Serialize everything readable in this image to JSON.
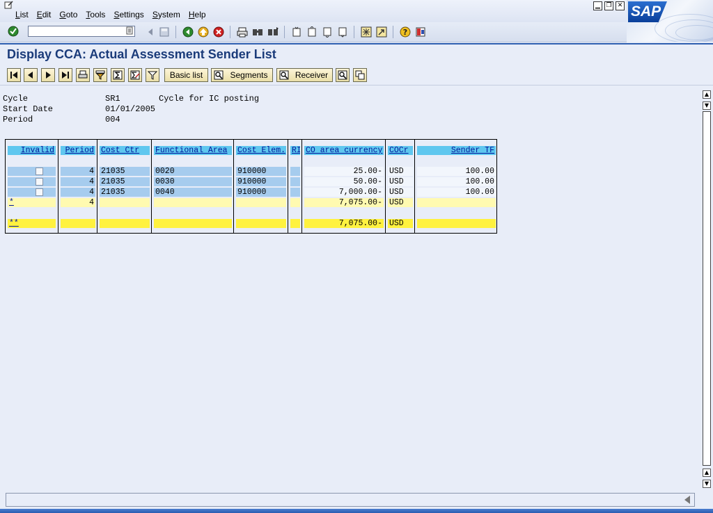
{
  "menu": {
    "items": [
      "List",
      "Edit",
      "Goto",
      "Tools",
      "Settings",
      "System",
      "Help"
    ]
  },
  "logo_text": "SAP",
  "window_controls": [
    "minimize-icon",
    "restore-icon",
    "close-icon"
  ],
  "command_field": {
    "value": ""
  },
  "page_title": "Display CCA: Actual Assessment Sender List",
  "app_toolbar": {
    "basic_list": "Basic list",
    "segments": "Segments",
    "receiver": "Receiver"
  },
  "header_info": {
    "cycle_label": "Cycle",
    "cycle_value": "SR1",
    "cycle_desc": "Cycle for IC posting",
    "start_label": "Start Date",
    "start_value": "01/01/2005",
    "period_label": "Period",
    "period_value": "004"
  },
  "table": {
    "columns": [
      "Invalid",
      "Period",
      "Cost Ctr",
      "Functional Area",
      "Cost Elem.",
      "RI",
      "CO area currency",
      "COCr",
      "Sender TF"
    ],
    "rows": [
      {
        "period": "4",
        "cost_ctr": "21035",
        "func_area": "0020",
        "cost_elem": "910000",
        "amount": "25.00-",
        "cocr": "USD",
        "sender_tf": "100.00"
      },
      {
        "period": "4",
        "cost_ctr": "21035",
        "func_area": "0030",
        "cost_elem": "910000",
        "amount": "50.00-",
        "cocr": "USD",
        "sender_tf": "100.00"
      },
      {
        "period": "4",
        "cost_ctr": "21035",
        "func_area": "0040",
        "cost_elem": "910000",
        "amount": "7,000.00-",
        "cocr": "USD",
        "sender_tf": "100.00"
      }
    ],
    "subtotal": {
      "marker": "*",
      "period": "4",
      "amount": "7,075.00-",
      "cocr": "USD"
    },
    "total": {
      "marker": "**",
      "amount": "7,075.00-",
      "cocr": "USD"
    }
  },
  "colors": {
    "header_blue": "#5fc7ef",
    "key_blue": "#a6ccee",
    "subtotal_yellow": "#fffab0",
    "total_yellow": "#fff23f",
    "title_blue": "#1a3b7a"
  }
}
